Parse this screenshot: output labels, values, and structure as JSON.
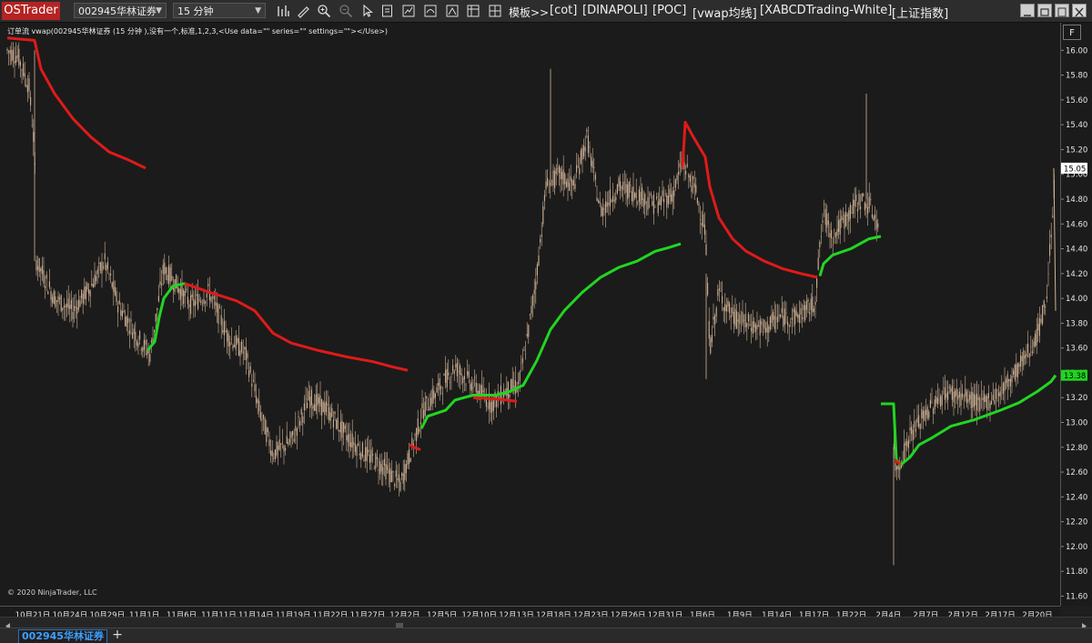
{
  "toolbar": {
    "brand": "OSTrader",
    "instrument": "002945华林证券",
    "interval": "15 分钟",
    "template_menu": "模板>>",
    "tags": [
      "[cot]",
      "[DINAPOLI]",
      "[POC]",
      "[vwap均线]",
      "[XABCDTrading-White]",
      "[上证指数]"
    ],
    "icons": [
      "bar-style-icon",
      "draw-tool-icon",
      "zoom-in-icon",
      "zoom-out-icon",
      "cursor-icon",
      "properties-icon",
      "strategy-icon",
      "indicator-icon",
      "template-icon",
      "data-box-icon"
    ]
  },
  "chart": {
    "title": "订单流 vwap(002945华林证券 (15 分钟 ),没有一个,标准,1,2,3,<Use data=\"\" series=\"\" settings=\"\"></Use>)",
    "copyright": "© 2020 NinjaTrader, LLC",
    "f_button": "F",
    "colors": {
      "background": "#1b1b1b",
      "candle": "#d2b496",
      "vwap_up": "#22d522",
      "vwap_down": "#e01a1a",
      "last_price": "#ffffff",
      "vwap_label": "#1fd41f"
    }
  },
  "price_axis": {
    "ticks": [
      "16.00",
      "15.80",
      "15.60",
      "15.40",
      "15.20",
      "15.00",
      "14.80",
      "14.60",
      "14.40",
      "14.20",
      "14.00",
      "13.80",
      "13.60",
      "13.40",
      "13.20",
      "13.00",
      "12.80",
      "12.60",
      "12.40",
      "12.20",
      "12.00",
      "11.80",
      "11.60"
    ],
    "last_price": "15.05",
    "vwap_value": "13.38"
  },
  "time_axis": {
    "ticks": [
      "10月21日",
      "10月24日",
      "10月29日",
      "11月1日",
      "11月6日",
      "11月11日",
      "11月14日",
      "11月19日",
      "11月22日",
      "11月27日",
      "12月2日",
      "12月5日",
      "12月10日",
      "12月13日",
      "12月18日",
      "12月23日",
      "12月26日",
      "12月31日",
      "1月6日",
      "1月9日",
      "1月14日",
      "1月17日",
      "1月22日",
      "2月4日",
      "2月7日",
      "2月12日",
      "2月17日",
      "2月20日"
    ]
  },
  "tabs": {
    "active": "002945华林证券",
    "add": "+"
  },
  "chart_data": {
    "type": "line",
    "series": [
      {
        "x_label": "10月21日",
        "y": 16.1
      },
      {
        "x_label": "11月1日",
        "y": 15.05
      },
      {
        "x_label": "11月6日",
        "y": 14.12
      },
      {
        "x_label": "11月27日",
        "y": 13.52
      },
      {
        "x_label": "12月2日",
        "y": 12.8
      },
      {
        "x_label": "12月13日",
        "y": 13.2
      },
      {
        "x_label": "12月31日",
        "y": 14.44
      },
      {
        "x_label": "1月17日",
        "y": 14.17
      },
      {
        "x_label": "1月22日",
        "y": 14.5
      },
      {
        "x_label": "2月4日",
        "y": 12.66
      },
      {
        "x_label": "2月20日",
        "y": 13.38
      }
    ],
    "ylim": [
      11.56,
      16.08
    ]
  }
}
